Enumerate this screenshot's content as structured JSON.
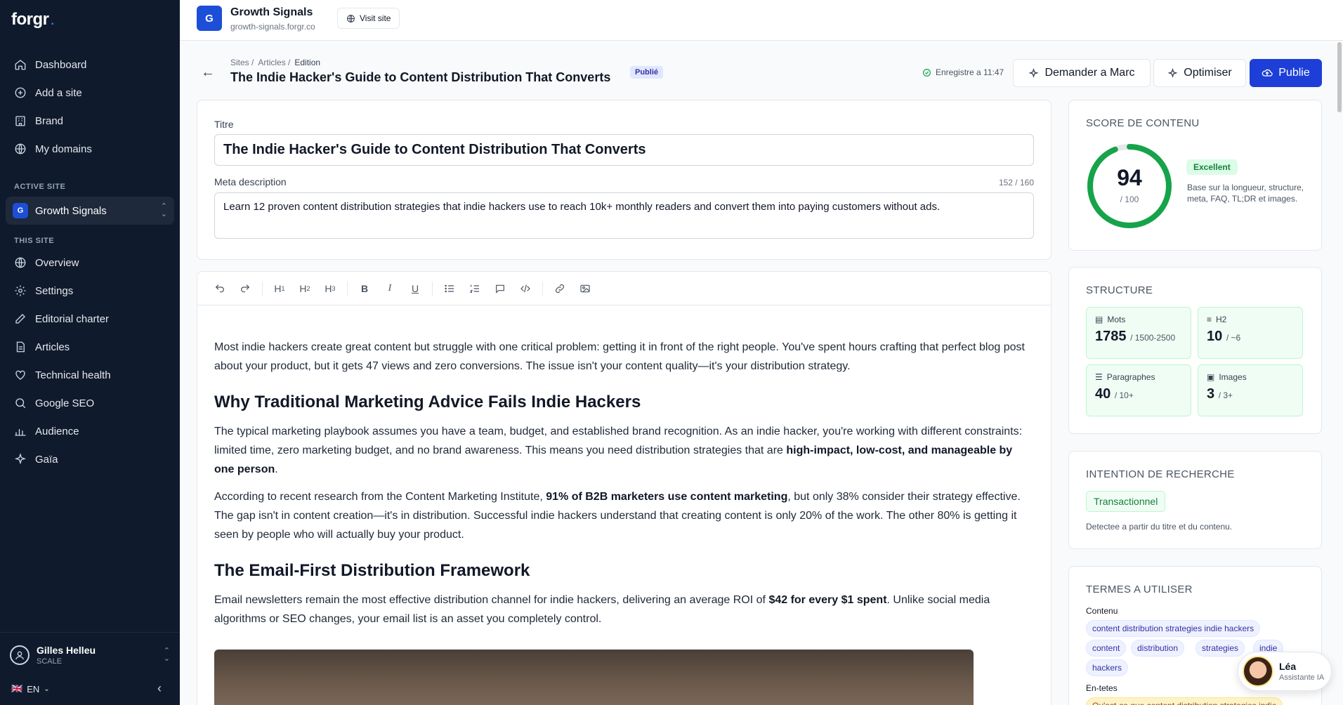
{
  "sidebar": {
    "logo": "forgr",
    "logo_dot": ".",
    "nav": [
      {
        "label": "Dashboard",
        "icon": "home-icon"
      },
      {
        "label": "Add a site",
        "icon": "plus-circle-icon"
      },
      {
        "label": "Brand",
        "icon": "building-icon"
      },
      {
        "label": "My domains",
        "icon": "globe-icon"
      }
    ],
    "active_site_label": "ACTIVE SITE",
    "active_site": {
      "badge": "G",
      "name": "Growth Signals"
    },
    "this_site_label": "THIS SITE",
    "site_nav": [
      {
        "label": "Overview",
        "icon": "globe-icon"
      },
      {
        "label": "Settings",
        "icon": "gear-icon"
      },
      {
        "label": "Editorial charter",
        "icon": "pencil-icon"
      },
      {
        "label": "Articles",
        "icon": "document-icon"
      },
      {
        "label": "Technical health",
        "icon": "heart-icon"
      },
      {
        "label": "Google SEO",
        "icon": "search-icon"
      },
      {
        "label": "Audience",
        "icon": "bar-chart-icon"
      },
      {
        "label": "Gaïa",
        "icon": "sparkle-icon"
      }
    ],
    "user": {
      "name": "Gilles Helleu",
      "plan": "SCALE"
    },
    "language": "EN",
    "language_flag": "🇬🇧"
  },
  "topbar": {
    "site_badge": "G",
    "site_name": "Growth Signals",
    "site_url": "growth-signals.forgr.co",
    "visit_label": "Visit site"
  },
  "header": {
    "breadcrumb": [
      "Sites",
      "Articles",
      "Edition"
    ],
    "title": "The Indie Hacker's Guide to Content Distribution That Converts",
    "status": "Publié",
    "saved_text": "Enregistre a 11:47",
    "ask_label": "Demander a Marc",
    "optimize_label": "Optimiser",
    "publish_label": "Publie"
  },
  "meta": {
    "title_label": "Titre",
    "title_value": "The Indie Hacker's Guide to Content Distribution That Converts",
    "description_label": "Meta description",
    "description_counter": "152 / 160",
    "description_value": "Learn 12 proven content distribution strategies that indie hackers use to reach 10k+ monthly readers and convert them into paying customers without ads."
  },
  "editor": {
    "p1": "Most indie hackers create great content but struggle with one critical problem: getting it in front of the right people. You've spent hours crafting that perfect blog post about your product, but it gets 47 views and zero conversions. The issue isn't your content quality—it's your distribution strategy.",
    "h2_1": "Why Traditional Marketing Advice Fails Indie Hackers",
    "p2_a": "The typical marketing playbook assumes you have a team, budget, and established brand recognition. As an indie hacker, you're working with different constraints: limited time, zero marketing budget, and no brand awareness. This means you need distribution strategies that are ",
    "p2_b": "high-impact, low-cost, and manageable by one person",
    "p2_c": ".",
    "p3_a": "According to recent research from the Content Marketing Institute, ",
    "p3_b": "91% of B2B marketers use content marketing",
    "p3_c": ", but only 38% consider their strategy effective. The gap isn't in content creation—it's in distribution. Successful indie hackers understand that creating content is only 20% of the work. The other 80% is getting it seen by people who will actually buy your product.",
    "h2_2": "The Email-First Distribution Framework",
    "p4_a": "Email newsletters remain the most effective distribution channel for indie hackers, delivering an average ROI of ",
    "p4_b": "$42 for every $1 spent",
    "p4_c": ". Unlike social media algorithms or SEO changes, your email list is an asset you completely control."
  },
  "score": {
    "title": "SCORE DE CONTENU",
    "value": 94,
    "value_text": "94",
    "max_text": "/ 100",
    "badge": "Excellent",
    "note": "Base sur la longueur, structure, meta, FAQ, TL;DR et images.",
    "color": "#16a34a"
  },
  "structure": {
    "title": "STRUCTURE",
    "stats": [
      {
        "label": "Mots",
        "value": "1785",
        "target": "/ 1500-2500",
        "icon": "document-icon"
      },
      {
        "label": "H2",
        "value": "10",
        "target": "/ ~6",
        "icon": "lines-icon"
      },
      {
        "label": "Paragraphes",
        "value": "40",
        "target": "/ 10+",
        "icon": "paragraph-icon"
      },
      {
        "label": "Images",
        "value": "3",
        "target": "/ 3+",
        "icon": "image-icon"
      }
    ]
  },
  "intent": {
    "title": "INTENTION DE RECHERCHE",
    "value": "Transactionnel",
    "note": "Detectee a partir du titre et du contenu."
  },
  "terms": {
    "title": "TERMES A UTILISER",
    "content_label": "Contenu",
    "content_terms": [
      "content distribution strategies indie hackers",
      "content",
      "distribution",
      "strategies",
      "indie",
      "hackers"
    ],
    "headers_label": "En-tetes",
    "header_terms": [
      "Qu'est-ce que content distribution strategies indie"
    ]
  },
  "assistant": {
    "name": "Léa",
    "role": "Assistante IA"
  }
}
